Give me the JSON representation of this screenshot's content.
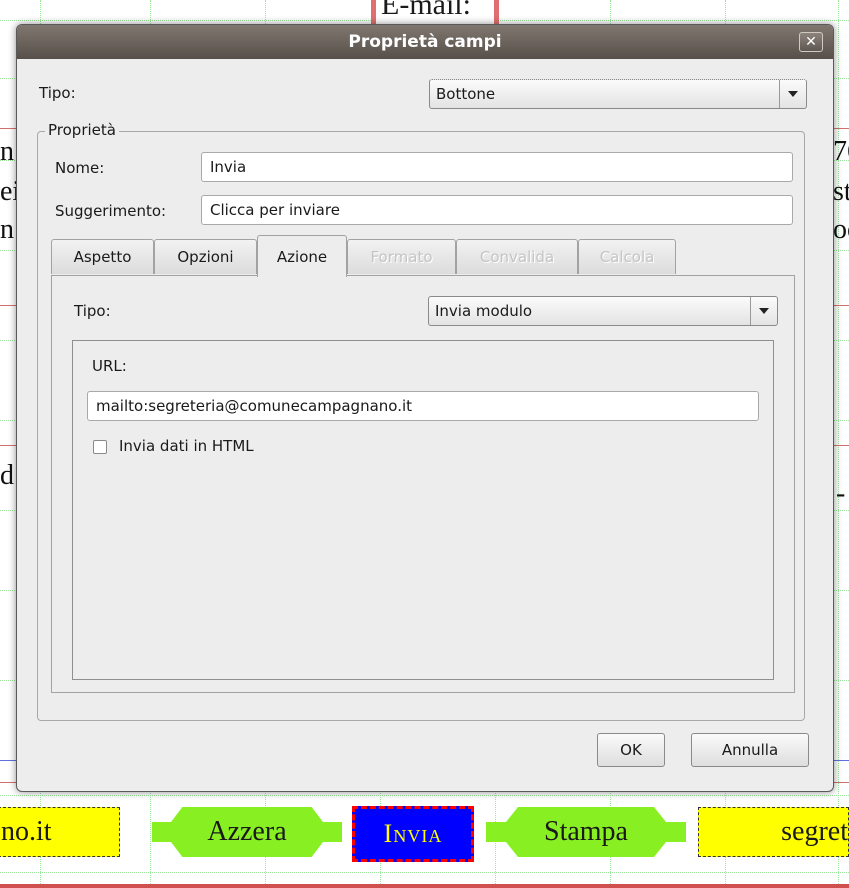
{
  "background": {
    "email_label": "E-mail:",
    "fragments": [
      "n",
      "ei",
      "n",
      "d",
      "76",
      "st",
      "oc",
      "-"
    ],
    "field_left": "no.it",
    "btn_reset": "Azzera",
    "btn_submit": "Invia",
    "btn_print": "Stampa",
    "field_right": "segret"
  },
  "dialog": {
    "title": "Proprietà campi",
    "close_symbol": "✕",
    "type_label": "Tipo:",
    "type_value": "Bottone",
    "group_label": "Proprietà",
    "name_label": "Nome:",
    "name_value": "Invia",
    "tooltip_label": "Suggerimento:",
    "tooltip_value": "Clicca per inviare",
    "tabs": [
      {
        "label": "Aspetto",
        "state": "normal"
      },
      {
        "label": "Opzioni",
        "state": "normal"
      },
      {
        "label": "Azione",
        "state": "active"
      },
      {
        "label": "Formato",
        "state": "disabled"
      },
      {
        "label": "Convalida",
        "state": "disabled"
      },
      {
        "label": "Calcola",
        "state": "disabled"
      }
    ],
    "action": {
      "type_label": "Tipo:",
      "type_value": "Invia modulo",
      "url_label": "URL:",
      "url_value": "mailto:segreteria@comunecampagnano.it",
      "html_checkbox_label": "Invia dati in HTML",
      "html_checkbox_checked": false
    },
    "ok_label": "OK",
    "cancel_label": "Annulla"
  }
}
